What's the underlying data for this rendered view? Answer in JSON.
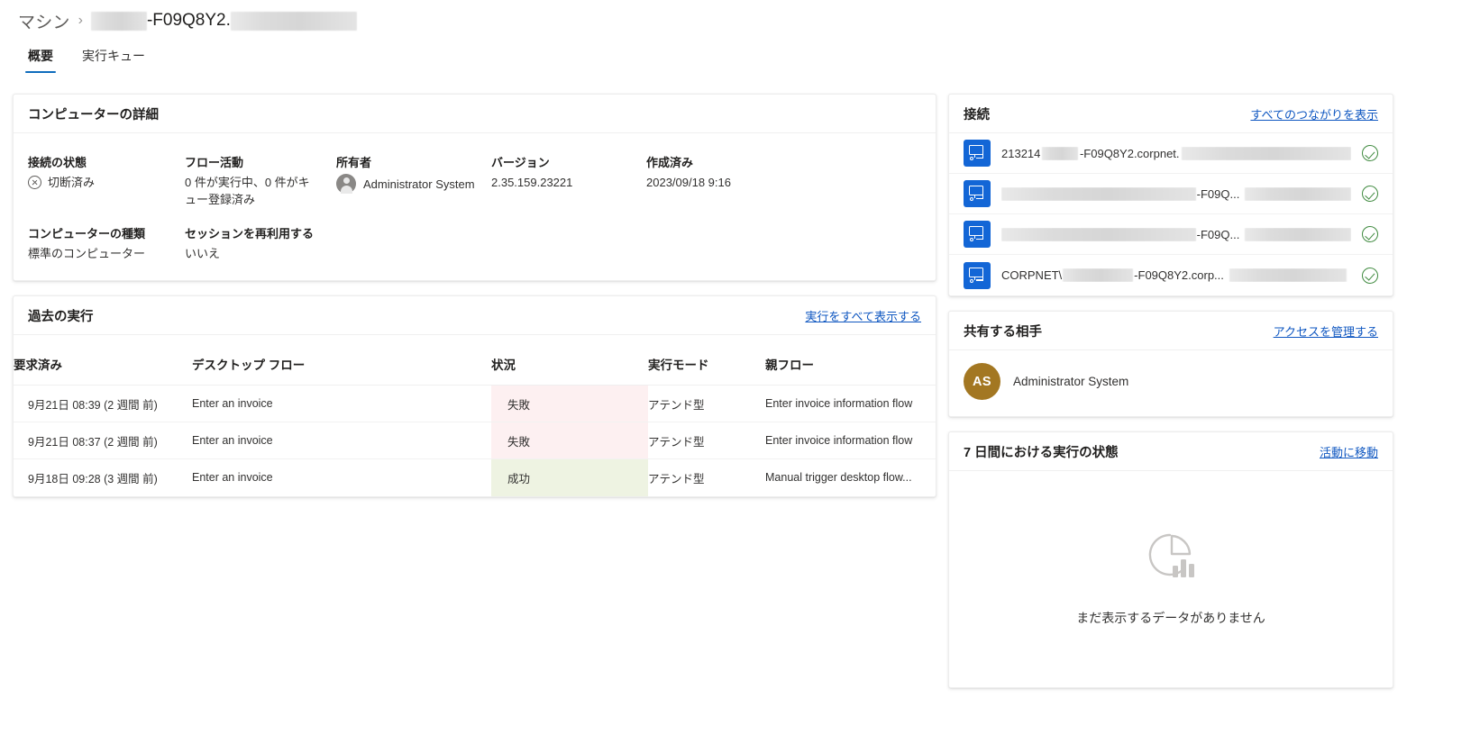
{
  "breadcrumb": {
    "root": "マシン",
    "separator": "›",
    "current": "-F09Q8Y2.",
    "redacted": true
  },
  "tabs": [
    {
      "label": "概要",
      "active": true
    },
    {
      "label": "実行キュー",
      "active": false
    }
  ],
  "details": {
    "title": "コンピューターの詳細",
    "fields": [
      {
        "label": "接続の状態",
        "value": "切断済み",
        "icon": "circle-x-icon"
      },
      {
        "label": "フロー活動",
        "value": "0 件が実行中、0 件がキュー登録済み"
      },
      {
        "label": "所有者",
        "value": "Administrator System",
        "icon": "person-avatar"
      },
      {
        "label": "バージョン",
        "value": "2.35.159.23221"
      },
      {
        "label": "作成済み",
        "value": "2023/09/18 9:16"
      },
      {
        "label": "コンピューターの種類",
        "value": "標準のコンピューター"
      },
      {
        "label": "セッションを再利用する",
        "value": "いいえ"
      }
    ]
  },
  "runs": {
    "title": "過去の実行",
    "link": "実行をすべて表示する",
    "columns": [
      "要求済み",
      "デスクトップ フロー",
      "状況",
      "実行モード",
      "親フロー"
    ],
    "rows": [
      {
        "requested": "9月21日 08:39 (2 週間 前)",
        "flow": "Enter an invoice",
        "status": "失敗",
        "status_kind": "fail",
        "mode": "アテンド型",
        "parent": "Enter invoice information flow"
      },
      {
        "requested": "9月21日 08:37 (2 週間 前)",
        "flow": "Enter an invoice",
        "status": "失敗",
        "status_kind": "fail",
        "mode": "アテンド型",
        "parent": "Enter invoice information flow"
      },
      {
        "requested": "9月18日 09:28 (3 週間 前)",
        "flow": "Enter an invoice",
        "status": "成功",
        "status_kind": "ok",
        "mode": "アテンド型",
        "parent": "Manual trigger desktop flow..."
      }
    ]
  },
  "connections": {
    "title": "接続",
    "link": "すべてのつながりを表示",
    "items": [
      {
        "prefix": "213214",
        "middle": "-F09Q8Y2.corpnet.",
        "redacted_lead": false,
        "status_icon": "check-circle-icon"
      },
      {
        "prefix": "",
        "middle": "-F09Q...",
        "redacted_lead": true,
        "status_icon": "check-circle-icon"
      },
      {
        "prefix": "",
        "middle": "-F09Q...",
        "redacted_lead": true,
        "status_icon": "check-circle-icon"
      },
      {
        "prefix": "CORPNET\\",
        "middle": "-F09Q8Y2.corp...",
        "redacted_lead": false,
        "status_icon": "check-circle-icon"
      }
    ]
  },
  "share": {
    "title": "共有する相手",
    "link": "アクセスを管理する",
    "person": {
      "initials": "AS",
      "name": "Administrator System"
    }
  },
  "status7": {
    "title": "7 日間における実行の状態",
    "link": "活動に移動",
    "empty_text": "まだ表示するデータがありません",
    "empty_icon": "pie-chart-bar-icon"
  },
  "colors": {
    "accent": "#0f6cbd",
    "link": "#0f57c1",
    "fail_bg": "#fdf0f1",
    "success_bg": "#eef3e2",
    "conn_icon_bg": "#1366d6",
    "avatar_bg": "#a37722",
    "check": "#3f8a3f"
  }
}
